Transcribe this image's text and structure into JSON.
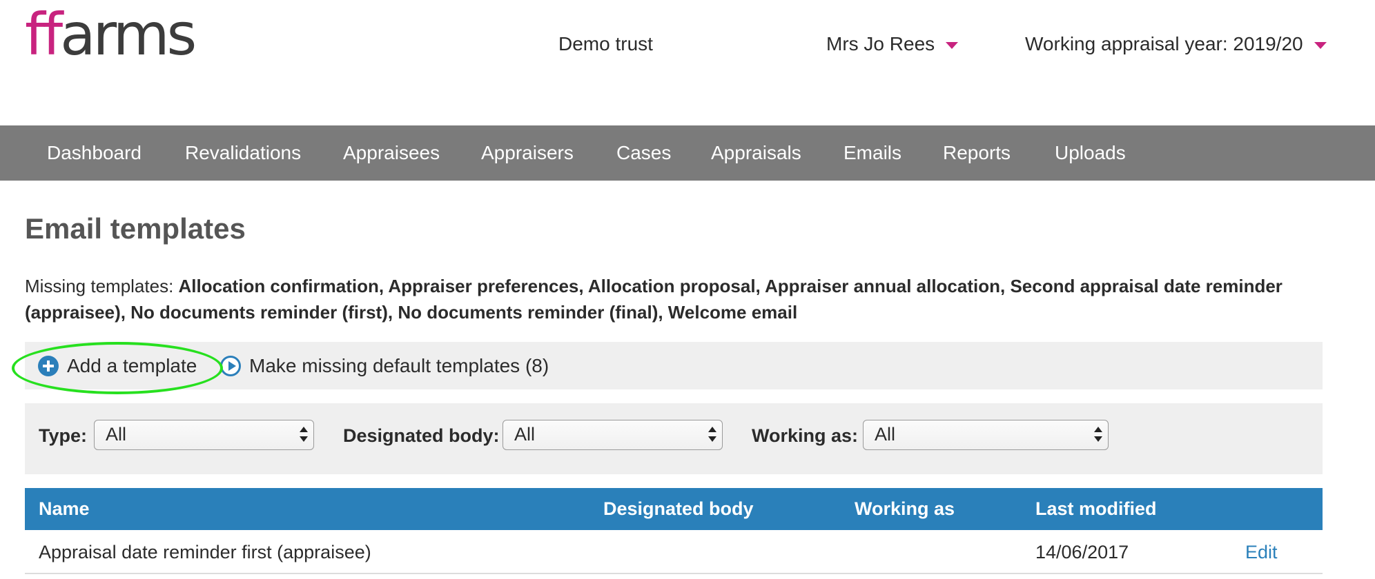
{
  "brand": {
    "logo_ff": "ff",
    "logo_rest": "arms",
    "accent_color": "#c8237f"
  },
  "header": {
    "trust": "Demo trust",
    "user": "Mrs Jo Rees",
    "year": "Working appraisal year: 2019/20"
  },
  "nav": {
    "items": [
      "Dashboard",
      "Revalidations",
      "Appraisees",
      "Appraisers",
      "Cases",
      "Appraisals",
      "Emails",
      "Reports",
      "Uploads"
    ],
    "background_color": "#7b7b7b"
  },
  "page": {
    "title": "Email templates",
    "missing_label": "Missing templates: ",
    "missing_list": "Allocation confirmation, Appraiser preferences, Allocation proposal, Appraiser annual allocation, Second appraisal date reminder (appraisee), No documents reminder (first), No documents reminder (final), Welcome email"
  },
  "actions": {
    "add_template": "Add a template",
    "make_defaults": "Make missing default templates (8)",
    "highlight_color": "#27e01f"
  },
  "filters": {
    "type_label": "Type:",
    "type_value": "All",
    "body_label": "Designated body:",
    "body_value": "All",
    "working_label": "Working as:",
    "working_value": "All"
  },
  "table": {
    "header_color": "#2a80ba",
    "columns": [
      "Name",
      "Designated body",
      "Working as",
      "Last modified"
    ],
    "rows": [
      {
        "name": "Appraisal date reminder first (appraisee)",
        "designated_body": "",
        "working_as": "",
        "last_modified": "14/06/2017",
        "action": "Edit"
      }
    ]
  }
}
